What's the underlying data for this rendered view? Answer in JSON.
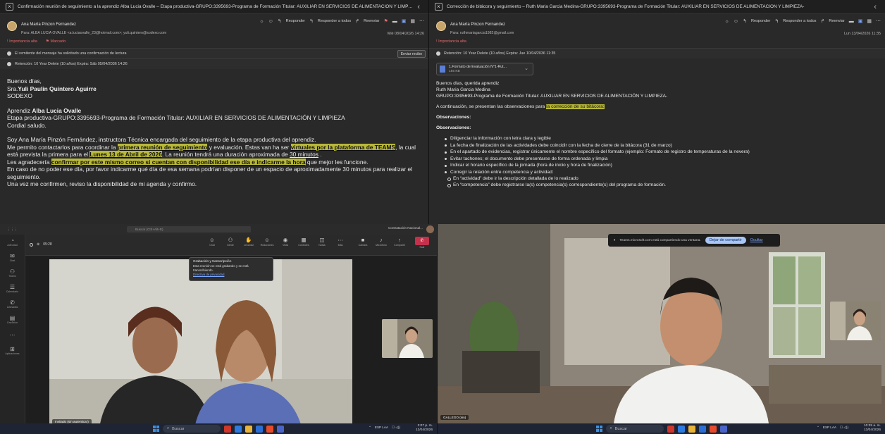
{
  "email1": {
    "title": "Confirmación reunión de seguimiento a la aprendiz Alba Lucia Ovalle – Etapa productiva-GRUPO:3395693-Programa de Formación Titular: AUXILIAR EN SERVICIOS DE ALIMENTACIÓN Y LIMPIEZA",
    "sender": "Ana María Pinzon Fernandez",
    "to_label": "Para:",
    "recipients": "ALBA LUCIA OVALLE <a.luciaovalle_23@hotmail.com>;  yuli.quintero@sodexo.com",
    "date": "Mié 08/04/2026 14:26",
    "toolbar": {
      "reply": "Responder",
      "reply_all": "Responder a todos",
      "forward": "Reenviar"
    },
    "importance": "Importancia alta",
    "flag": "Marcado",
    "read_receipt_notice": "El remitente del mensaje ha solicitado una confirmación de lectura",
    "read_receipt_button": "Enviar recibo",
    "retention": "Retención: 10 Year Delete (10 años) Expira: Sáb 05/04/2036 14:26",
    "body": {
      "greeting": "Buenos días,",
      "recipient_prefix": "Sra.",
      "recipient_name": "Yuli Paulin Quintero Aguirre",
      "company": "SODEXO",
      "aprendiz_prefix": "Aprendiz",
      "aprendiz_name": "Alba Lucia Ovalle",
      "etapa": "Etapa productiva-GRUPO:3395693-Programa de Formación Titular: AUXILIAR EN SERVICIOS DE ALIMENTACIÓN Y LIMPIEZA",
      "cordial": "Cordial saludo.",
      "intro": "Soy Ana María Pinzón Fernández, instructora Técnica encargada del seguimiento de la etapa productiva del aprendiz.",
      "p1_a": "Me permito contactarlos para coordinar la",
      "p1_hl1": "primera reunión de seguimiento",
      "p1_b": "y evaluación. Estas van ha ser",
      "p1_hl2": "virtuales por la plataforma de  TEAMS",
      "p1_c": ", la cual está prevista la primera para el",
      "p1_hl3": "Lunes 13 de Abril de 2026",
      "p1_d": ". La reunión tendrá una duración aproximada de",
      "p1_ul": "30 minutos",
      "p1_e": ".",
      "p2_a": "Les agradecería",
      "p2_hl": "confirmar por este mismo correo si cuentan con disponibilidad ese día e indicarme la hora",
      "p2_b": "que mejor les funcione.",
      "p3": "En caso de no poder ese día, por favor indicarme qué día de esa semana podrían disponer de un espacio de aproximadamente 30 minutos para realizar el seguimiento.",
      "p4": "Una vez me confirmen, reviso la disponibilidad de mi agenda y confirmo."
    }
  },
  "email2": {
    "title": "Corrección de bitácora y seguimiento – Ruth Maria Garcia Medina-GRUPO:3395693-Programa de Formación Titular: AUXILIAR EN SERVICIOS DE ALIMENTACIÓN Y LIMPIEZA-",
    "sender": "Ana María Pinzon Fernandez",
    "to_label": "Para:",
    "recipients": "ruthmariagarcia1982@gmail.com",
    "date": "Lun 13/04/2026 11:35",
    "toolbar": {
      "reply": "Responder",
      "reply_all": "Responder a todos",
      "forward": "Reenviar"
    },
    "importance": "Importancia alta",
    "retention": "Retención: 10 Year Delete (10 años) Expira: Jue 10/04/2036 11:35",
    "attachment_name": "1.Formato de Evaluación N°1-Rut...",
    "attachment_size": "155 KB",
    "body": {
      "greeting": "Buenos días, querida aprendiz",
      "name": "Ruth Maria Garcia Medina",
      "grupo": "GRUPO:3395693-Programa de Formación Titular: AUXILIAR EN SERVICIOS DE ALIMENTACIÓN Y LIMPIEZA-",
      "intro_a": "A continuación, se presentan las observaciones para",
      "intro_hl": "la corrección de su bitácora:",
      "obs1": "Observaciones:",
      "obs2": "Observaciones:",
      "bullets": [
        "Diligenciar la información con letra clara y legible",
        "La fecha de finalización de las actividades debe coincidir con la fecha de cierre de la bitácora (31 de marzo)",
        "En el apartado de evidencias, registrar únicamente el nombre específico del formato (ejemplo: Formato de registro de temperaturas de la nevera)",
        "Evitar tachones; el documento debe presentarse de forma ordenada y limpia",
        "Indicar el horario específico de la jornada (hora de inicio y hora de finalización)",
        "Corregir la relación entre competencia y actividad:"
      ],
      "sub_bullets": [
        "En “actividad” debe ir la descripción detallada de lo realizado",
        "En “competencia” debe registrarse la(s) competencia(s) correspondiente(s) del programa de formación."
      ]
    }
  },
  "teams1": {
    "search": "Buscar (Ctrl+Alt+E)",
    "org": "Contratación Nacional...",
    "call_time": "05:28",
    "tools": [
      {
        "icon": "☺",
        "label": "Chat"
      },
      {
        "icon": "⚇",
        "label": "Gente"
      },
      {
        "icon": "✋",
        "label": "Levantar"
      },
      {
        "icon": "☺",
        "label": "Reacciones"
      },
      {
        "icon": "◉",
        "label": "Vista"
      },
      {
        "icon": "▦",
        "label": "Controles"
      },
      {
        "icon": "◫",
        "label": "Notas"
      },
      {
        "icon": "⋯",
        "label": "Más"
      },
      {
        "icon": "■",
        "label": "Cámara"
      },
      {
        "icon": "♪",
        "label": "Micrófono"
      },
      {
        "icon": "↑",
        "label": "Compartir"
      }
    ],
    "leave_label": "Salir",
    "rail": [
      {
        "icon": "◔",
        "label": "Actividad"
      },
      {
        "icon": "✉",
        "label": "Chat"
      },
      {
        "icon": "⚇",
        "label": "Teams"
      },
      {
        "icon": "☰",
        "label": "Calendario"
      },
      {
        "icon": "✆",
        "label": "Llamadas"
      },
      {
        "icon": "▤",
        "label": "OneDrive"
      },
      {
        "icon": "⋯",
        "label": ""
      },
      {
        "icon": "⊞",
        "label": "Aplicaciones"
      }
    ],
    "popup_title": "Grabación y transcripción",
    "popup_text": "Esta reunión se está grabando y se está transcribiendo.",
    "popup_link": "Directiva de privacidad",
    "name_chip": "Invitado (sin autenticar)",
    "taskbar_search": "Buscar",
    "tray_lang": "ESP\nLAA",
    "tray_time": "3:07 p. m.",
    "tray_date": "13/04/2026"
  },
  "teams2": {
    "share_text": "Teams.microsoft.com está compartiendo una ventana.",
    "share_stop": "Dejar de compartir",
    "share_hide": "Ocultar",
    "name_chip": "GALLEGO (sin)",
    "taskbar_search": "Buscar",
    "tray_lang": "ESP\nLAA",
    "tray_time": "10:35 a. m.",
    "tray_date": "13/04/2026"
  },
  "colors": {
    "highlight": "#b8b83a",
    "leave": "#c4314b",
    "accent": "#7da7ff",
    "importance": "#e76a6a"
  }
}
